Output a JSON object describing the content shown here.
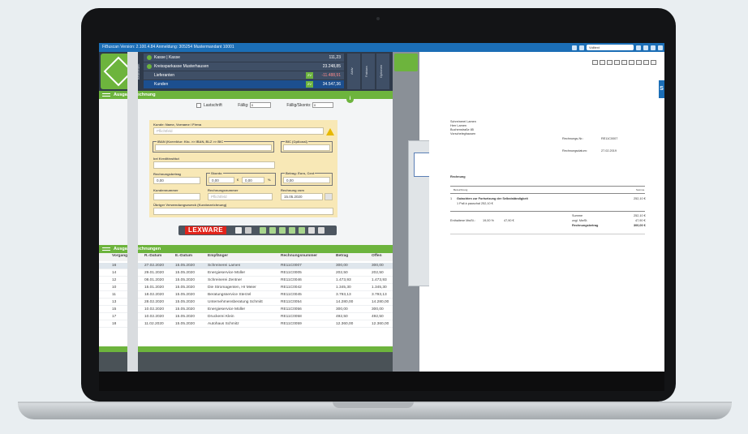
{
  "window": {
    "title": "FiBuscan Version: 2.100.4.84 Anmeldung: 305254 Mustermandant 10001",
    "search_placeholder": "Volltext"
  },
  "nav": {
    "rows": [
      {
        "label": "Kasse | Kasse",
        "value": "111,23"
      },
      {
        "label": "Kreissparkasse Musterhausen",
        "value": "23.248,85"
      },
      {
        "label": "Lieferanten",
        "badge": "ZV",
        "value": "-11.488,91"
      },
      {
        "label": "Kunden",
        "badge": "ZV",
        "value": "34.547,36"
      }
    ],
    "side_labels": [
      "Bearbeiten",
      "Aktiv",
      "Faktura",
      "Optionen"
    ]
  },
  "form": {
    "section_title": "Ausgangsrechnung",
    "lastschrift_label": "Lastschrift",
    "faellig_label": "Fällig:",
    "faellig_value": "0",
    "faellig_skonto_label": "Fällig/Skonto:",
    "faellig_skonto_value": "0",
    "kunde_label": "Kunde: Name, Vorname / Firma",
    "kunde_placeholder": "Pflichtfeld",
    "iban_label": "IBAN (Korrektur: Kto. >> IBAN, BLZ >> BIC",
    "bic_label": "BIC (Optional)",
    "kreditinstitut_label": "bei Kreditinstitut",
    "rechnungsbetrag_label": "Rechnungsbetrag",
    "rechnungsbetrag_value": "0,00",
    "skonto_label": "Skonto",
    "skonto_value": "0,00",
    "skonto_currency": "€",
    "skonto_percent_value": "0,00",
    "percent_sign": "%",
    "betrag_label": "Betrag: Euro, Cent",
    "betrag_value": "0,00",
    "kundennummer_label": "Kundennummer",
    "rechnungsnummer_label": "Rechnungsnummer",
    "rechnungsnummer_placeholder": "Pflichtfeld",
    "rechnung_vom_label": "Rechnung vom",
    "rechnung_vom_value": "15.05.2020",
    "verwendungszweck_label": "Übriger Verwendungszweck (Kurzbezeichnung)"
  },
  "toolbar": {
    "lexware_label": "LEXWARE"
  },
  "table": {
    "title": "Ausgangsrechnungen",
    "headers": [
      "Vorgang",
      "R.-Datum",
      "E.-Datum",
      "Empfänger",
      "Rechnungsnummer",
      "Betrag",
      "Offen"
    ],
    "rows": [
      [
        "16",
        "27.02.2020",
        "15.05.2020",
        "Schreinerei Lamen",
        "RE11C0007",
        "300,00",
        "300,00"
      ],
      [
        "14",
        "29.01.2020",
        "15.05.2020",
        "Energieservice Müller",
        "RE11C0005",
        "202,50",
        "202,50"
      ],
      [
        "12",
        "08.01.2020",
        "15.05.2020",
        "Schreinerei Zentner",
        "RE11C0046",
        "1.473,93",
        "1.473,93"
      ],
      [
        "10",
        "15.01.2020",
        "15.05.2020",
        "Die Stromagenten, Hr Meier",
        "RE11C0042",
        "1.345,30",
        "1.345,30"
      ],
      [
        "11",
        "18.02.2020",
        "15.05.2020",
        "Beratungsservice Sterzel",
        "RE11C0045",
        "3.793,13",
        "3.793,13"
      ],
      [
        "13",
        "28.02.2020",
        "15.05.2020",
        "Unternehmensberatung Schmitt",
        "RE11C0054",
        "14.280,00",
        "14.280,00"
      ],
      [
        "15",
        "10.02.2020",
        "15.05.2020",
        "Energieservice Müller",
        "RE11C0056",
        "300,00",
        "300,00"
      ],
      [
        "17",
        "10.02.2020",
        "15.05.2020",
        "Druckerei Klein",
        "RE11C0058",
        "492,50",
        "492,50"
      ],
      [
        "18",
        "11.02.2020",
        "15.05.2020",
        "Autohaus Schmitz",
        "RE11C0059",
        "12.360,00",
        "12.360,00"
      ]
    ]
  },
  "document": {
    "sender": [
      "Schreinerei Lamen",
      "Herr Lamen",
      "Buchenstraße 85",
      "Vorscheleghausen"
    ],
    "rechnung_nr_label": "Rechnungs-Nr.:",
    "rechnung_nr_value": "RE11C0007",
    "rechnungsdatum_label": "Rechnungsdatum:",
    "rechnungsdatum_value": "27.02.2019",
    "heading": "Rechnung",
    "col_bezeichnung": "Bezeichnung",
    "col_summe": "Summe",
    "position_nr": "1",
    "position_text": "Gutachten zur Fortsetzung der Selbstständigkeit",
    "position_sub": "1 Pall à pauschal 252,10 €",
    "position_value": "252,10 €",
    "summe_label": "Summe",
    "summe_value": "252,10 €",
    "mwst_label": "zzgl. MwSt.",
    "mwst_value": "47,90 €",
    "enthalten_label": "Enthaltene MwSt.:",
    "enthalten_pct": "19,00 %",
    "enthalten_value": "47,90 €",
    "betrag_label": "Rechnungsbetrag",
    "betrag_value": "300,00 €"
  },
  "colors": {
    "brand_green": "#6db43d",
    "title_blue": "#1b6eb6",
    "lexware_red": "#e2231a"
  }
}
